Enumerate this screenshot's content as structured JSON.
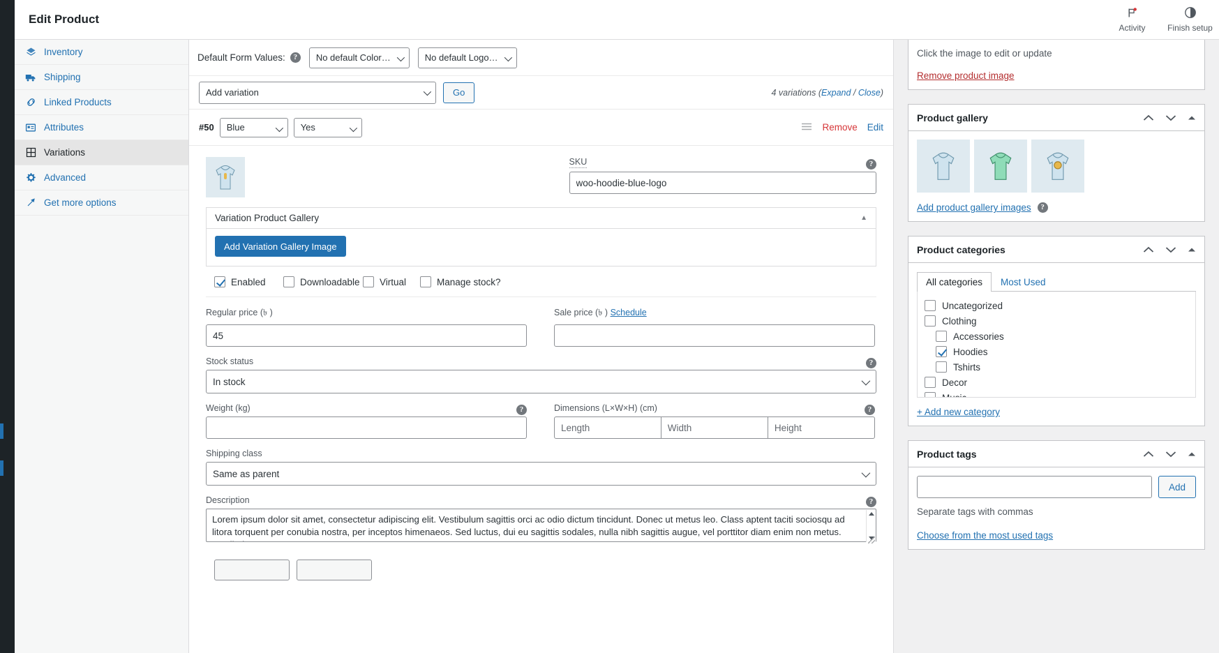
{
  "topbar": {
    "title": "Edit Product",
    "actions": [
      {
        "label": "Activity",
        "icon": "flag-icon"
      },
      {
        "label": "Finish setup",
        "icon": "half-circle-icon"
      }
    ]
  },
  "leftnav": {
    "items": [
      {
        "label": "Inventory",
        "icon": "inventory-icon",
        "active": false
      },
      {
        "label": "Shipping",
        "icon": "truck-icon",
        "active": false
      },
      {
        "label": "Linked Products",
        "icon": "link-icon",
        "active": false
      },
      {
        "label": "Attributes",
        "icon": "attributes-icon",
        "active": false
      },
      {
        "label": "Variations",
        "icon": "grid-icon",
        "active": true
      },
      {
        "label": "Advanced",
        "icon": "gear-icon",
        "active": false
      },
      {
        "label": "Get more options",
        "icon": "plug-icon",
        "active": false
      }
    ]
  },
  "default_form_values": {
    "label": "Default Form Values:",
    "color_select": "No default Color…",
    "logo_select": "No default Logo…"
  },
  "add_variation": {
    "select_value": "Add variation",
    "go_label": "Go",
    "count_text": "4 variations",
    "expand_label": "Expand",
    "separator": " / ",
    "close_label": "Close",
    "paren_open": "(",
    "paren_close": ")"
  },
  "variation": {
    "id": "#50",
    "attr_color": "Blue",
    "attr_logo": "Yes",
    "remove_label": "Remove",
    "edit_label": "Edit",
    "sku_label": "SKU",
    "sku_value": "woo-hoodie-blue-logo",
    "gallery_title": "Variation Product Gallery",
    "add_gallery_button": "Add Variation Gallery Image",
    "checkboxes": [
      {
        "label": "Enabled",
        "checked": true
      },
      {
        "label": "Downloadable",
        "checked": false
      },
      {
        "label": "Virtual",
        "checked": false
      },
      {
        "label": "Manage stock?",
        "checked": false
      }
    ],
    "regular_price_label": "Regular price (৳ )",
    "regular_price_value": "45",
    "sale_price_label": "Sale price (৳ )",
    "sale_price_value": "",
    "schedule_label": "Schedule",
    "stock_status_label": "Stock status",
    "stock_status_value": "In stock",
    "weight_label": "Weight (kg)",
    "weight_value": "",
    "dimensions_label": "Dimensions (L×W×H) (cm)",
    "dimensions_placeholders": [
      "Length",
      "Width",
      "Height"
    ],
    "shipping_class_label": "Shipping class",
    "shipping_class_value": "Same as parent",
    "description_label": "Description",
    "description_value": "Lorem ipsum dolor sit amet, consectetur adipiscing elit. Vestibulum sagittis orci ac odio dictum tincidunt. Donec ut metus leo. Class aptent taciti sociosqu ad litora torquent per conubia nostra, per inceptos himenaeos. Sed luctus, dui eu sagittis sodales, nulla nibh sagittis augue, vel porttitor diam enim non metus. Vestibulum"
  },
  "sidebar": {
    "featured": {
      "hint": "Click the image to edit or update",
      "remove_label": "Remove product image"
    },
    "gallery": {
      "title": "Product gallery",
      "thumbs": [
        "hoodie-blue-icon",
        "hoodie-green-icon",
        "hoodie-logo-icon"
      ],
      "add_label": "Add product gallery images"
    },
    "categories": {
      "title": "Product categories",
      "tabs": [
        {
          "label": "All categories",
          "active": true
        },
        {
          "label": "Most Used",
          "active": false
        }
      ],
      "items": [
        {
          "label": "Uncategorized",
          "checked": false,
          "child": false
        },
        {
          "label": "Clothing",
          "checked": false,
          "child": false
        },
        {
          "label": "Accessories",
          "checked": false,
          "child": true
        },
        {
          "label": "Hoodies",
          "checked": true,
          "child": true
        },
        {
          "label": "Tshirts",
          "checked": false,
          "child": true
        },
        {
          "label": "Decor",
          "checked": false,
          "child": false
        },
        {
          "label": "Music",
          "checked": false,
          "child": false
        }
      ],
      "add_new_label": "+ Add new category"
    },
    "tags": {
      "title": "Product tags",
      "input_value": "",
      "add_label": "Add",
      "hint": "Separate tags with commas",
      "choose_label": "Choose from the most used tags"
    }
  },
  "colors": {
    "accent": "#2271b1",
    "danger": "#d63638",
    "remove_image": "#b32d2e",
    "admin_dark": "#1d2327",
    "thumb_bg": "#dfeaf0"
  }
}
